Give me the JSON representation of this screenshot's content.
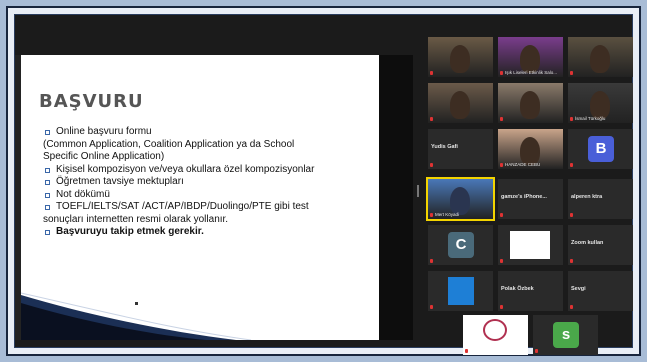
{
  "slide": {
    "title": "BAŞVURU",
    "bullets": [
      {
        "text": "Online başvuru formu",
        "bold": false
      },
      {
        "text": "(Common Application, Coalition Application ya da School",
        "bold": false,
        "sub": true
      },
      {
        "text": "Specific Online Application)",
        "bold": false,
        "sub": true
      },
      {
        "text": "Kişisel kompozisyon ve/veya okullara özel kompozisyonlar",
        "bold": false
      },
      {
        "text": "Öğretmen tavsiye mektupları",
        "bold": false
      },
      {
        "text": "Not dökümü",
        "bold": false
      },
      {
        "text": "TOEFL/IELTS/SAT /ACT/AP/IBDP/Duolingo/PTE gibi test",
        "bold": false
      },
      {
        "text": "sonuçları internetten resmi olarak yollanır.",
        "bold": false,
        "sub": true
      },
      {
        "text": "Başvuruyu takip etmek gerekir.",
        "bold": true
      }
    ]
  },
  "gallery": {
    "tiles": [
      {
        "id": "t1",
        "name": "",
        "big": "",
        "kind": "video",
        "accent": "#6a5a46"
      },
      {
        "id": "t2",
        "name": "Işık Liseleri Etkinlik Salo...",
        "big": "",
        "kind": "video",
        "accent": "#7a3d8c"
      },
      {
        "id": "t3",
        "name": "",
        "big": "",
        "kind": "video",
        "accent": "#5a5040"
      },
      {
        "id": "t4",
        "name": "",
        "big": "",
        "kind": "video",
        "accent": "#6b5a4a"
      },
      {
        "id": "t5",
        "name": "",
        "big": "",
        "kind": "video",
        "accent": "#8a7a6a"
      },
      {
        "id": "t6",
        "name": "İsmail Türkoğlu",
        "big": "",
        "kind": "video",
        "accent": "#3a3a3a"
      },
      {
        "id": "t7",
        "name": "",
        "big": "Yudis Gafi",
        "kind": "text",
        "accent": "#2a2a2a"
      },
      {
        "id": "t8",
        "name": "HANZADE CEBU",
        "big": "",
        "kind": "video",
        "accent": "#c9a48a"
      },
      {
        "id": "t9",
        "name": "",
        "big": "",
        "kind": "avatar",
        "letter": "B",
        "accent": "#4a5fd8"
      },
      {
        "id": "t10",
        "name": "Mert Köyadi",
        "big": "",
        "kind": "active",
        "accent": "#4a78b8"
      },
      {
        "id": "t11",
        "name": "",
        "big": "gamze's iPhone...",
        "kind": "text",
        "accent": "#2a2a2a"
      },
      {
        "id": "t12",
        "name": "",
        "big": "alperen ktra",
        "kind": "text",
        "accent": "#2a2a2a"
      },
      {
        "id": "t13",
        "name": "",
        "big": "",
        "kind": "avatar",
        "letter": "C",
        "accent": "#4a6a7a"
      },
      {
        "id": "t14",
        "name": "",
        "big": "",
        "kind": "white",
        "accent": "#ffffff"
      },
      {
        "id": "t15",
        "name": "",
        "big": "Zoom kullan",
        "kind": "text",
        "accent": "#2a2a2a"
      },
      {
        "id": "t16",
        "name": "",
        "big": "",
        "kind": "blue",
        "accent": "#1e7fd6"
      },
      {
        "id": "t17",
        "name": "",
        "big": "Polak Özbek",
        "kind": "text",
        "accent": "#2a2a2a"
      },
      {
        "id": "t18",
        "name": "",
        "big": "Sevgi",
        "kind": "text",
        "accent": "#2a2a2a"
      },
      {
        "id": "t19",
        "name": "",
        "big": "",
        "kind": "logo",
        "accent": "#ffffff"
      },
      {
        "id": "t20",
        "name": "",
        "big": "",
        "kind": "avatar",
        "letter": "s",
        "accent": "#4aa84a"
      }
    ]
  }
}
